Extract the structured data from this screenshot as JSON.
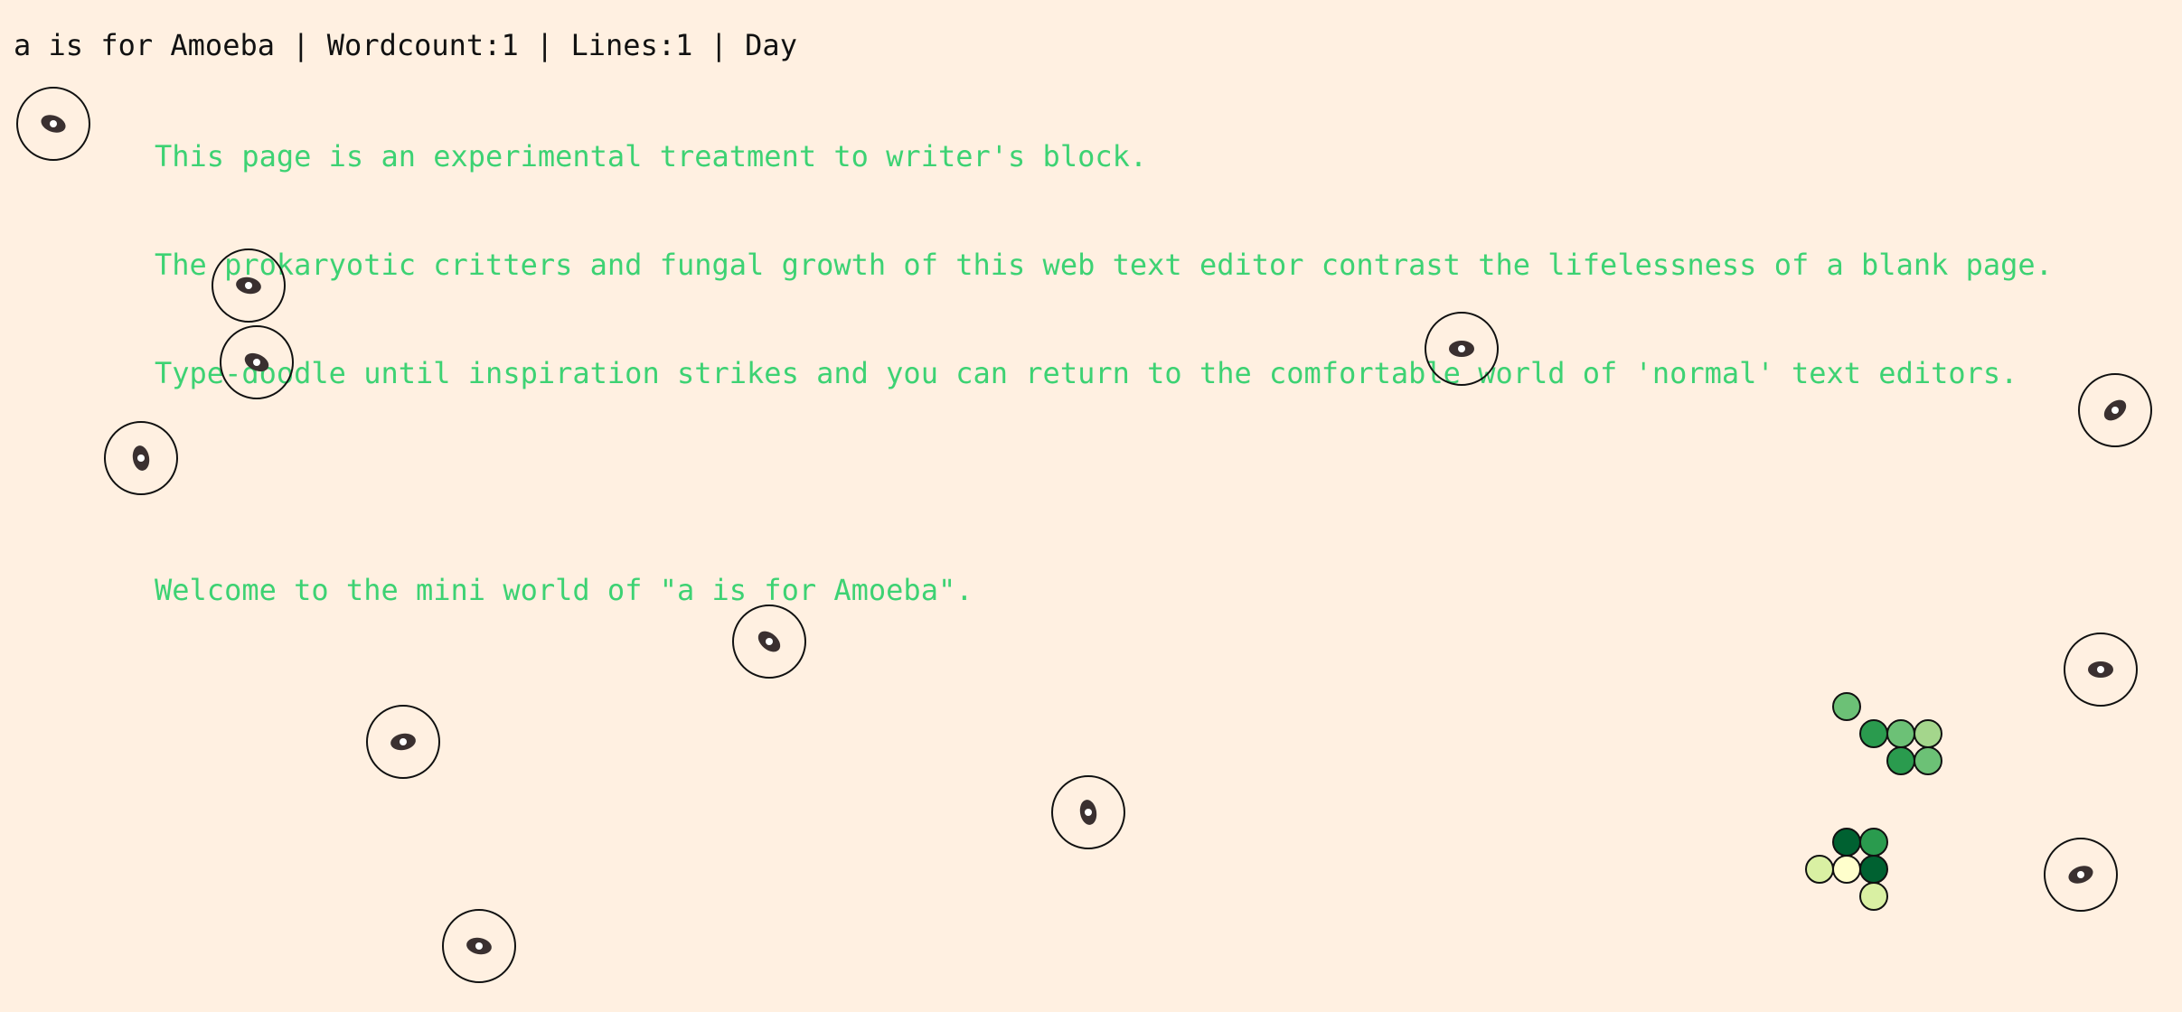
{
  "status_bar": {
    "title": "a is for Amoeba",
    "separator": "|",
    "wordcount": "Wordcount:1",
    "lines": "Lines:1",
    "mode": "Day"
  },
  "editor": {
    "intro_lines": [
      "This page is an experimental treatment to writer's block.",
      "The prokaryotic critters and fungal growth of this web text editor contrast the lifelessness of a blank page.",
      "Type-doodle until inspiration strikes and you can return to the comfortable world of 'normal' text editors.",
      "",
      "Welcome to the mini world of \"a is for Amoeba\"."
    ]
  },
  "colors": {
    "background": "#fff0e1",
    "intro_text": "#3dd273",
    "status_text": "#111111",
    "amoeba_outline": "#111111",
    "amoeba_nucleus": "#3a3030",
    "fungus_palette": [
      "#006131",
      "#2a9b4e",
      "#6cc176",
      "#a4d68c",
      "#d9f0a3",
      "#ffffcc"
    ]
  },
  "icons": {
    "amoeba": "amoeba-icon",
    "fungus_spore": "fungus-spore-icon"
  }
}
